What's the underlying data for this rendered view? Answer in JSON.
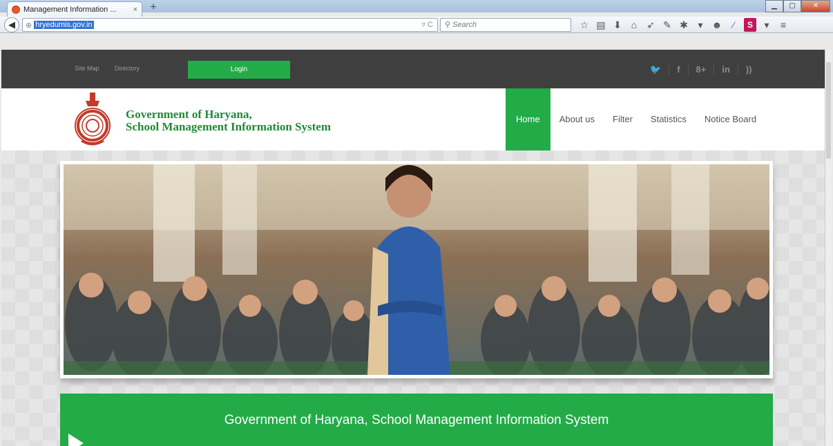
{
  "browser": {
    "tab_title": "Management Information ...",
    "tab_close": "×",
    "new_tab": "+",
    "url": "hryedumis.gov.in",
    "search_placeholder": "Search"
  },
  "topbar": {
    "links": [
      "Site Map",
      "Directory"
    ],
    "login_label": "Login",
    "social": [
      "twitter-icon",
      "facebook-icon",
      "google-plus-icon",
      "linkedin-icon",
      "rss-icon"
    ]
  },
  "header": {
    "brand_line1": "Government of Haryana,",
    "brand_line2": "School Management Information System",
    "menu": [
      "Home",
      "About us",
      "Filter",
      "Statistics",
      "Notice Board"
    ],
    "active_menu": "Home"
  },
  "banner": {
    "text": "Government of Haryana, School Management Information System"
  },
  "colors": {
    "accent_green": "#23ab47",
    "brand_green": "#1e8a35",
    "topbar_bg": "#3f3f3f"
  }
}
